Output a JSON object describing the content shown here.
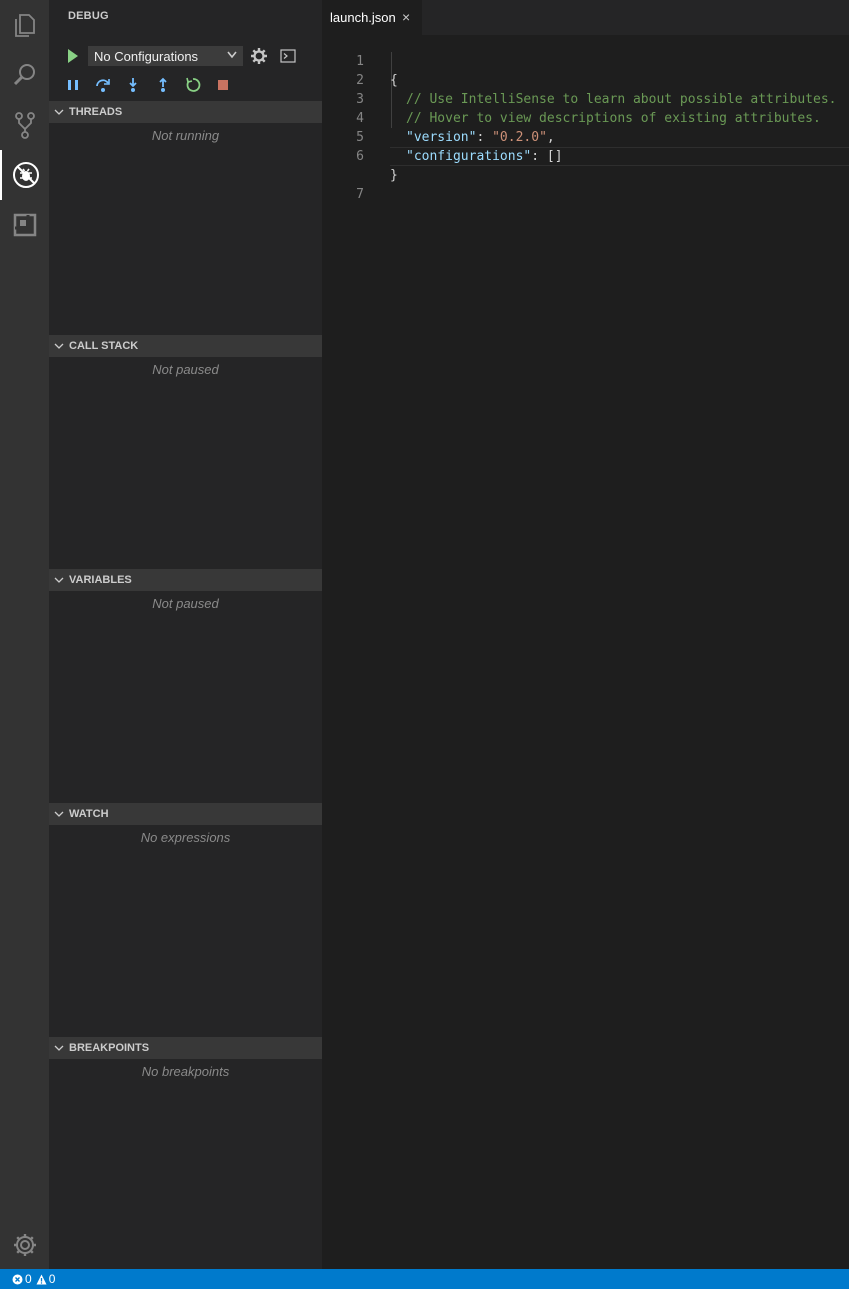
{
  "activity_bar": {
    "items": [
      {
        "icon": "files-icon"
      },
      {
        "icon": "search-icon"
      },
      {
        "icon": "source-control-icon"
      },
      {
        "icon": "debug-icon",
        "active": true
      },
      {
        "icon": "extensions-icon"
      }
    ],
    "settings_icon": "gear-icon"
  },
  "sidebar": {
    "title": "DEBUG",
    "config_select": "No Configurations",
    "sections": [
      {
        "label": "THREADS",
        "status": "Not running"
      },
      {
        "label": "CALL STACK",
        "status": "Not paused"
      },
      {
        "label": "VARIABLES",
        "status": "Not paused"
      },
      {
        "label": "WATCH",
        "status": "No expressions"
      },
      {
        "label": "BREAKPOINTS",
        "status": "No breakpoints"
      }
    ]
  },
  "editor": {
    "tab": {
      "label": "launch.json",
      "close": "×"
    },
    "lines": [
      {
        "no": "1",
        "text": "{"
      },
      {
        "no": "2",
        "text": "// Use IntelliSense to learn about possible attributes."
      },
      {
        "no": "3",
        "text": "// Hover to view descriptions of existing attributes."
      },
      {
        "no": "4",
        "key": "\"version\"",
        "sep": ": ",
        "value": "\"0.2.0\"",
        "end": ","
      },
      {
        "no": "5",
        "key": "\"configurations\"",
        "sep": ": ",
        "value": "[]",
        "end": ""
      },
      {
        "no": "6",
        "text": "}"
      },
      {
        "no": "7",
        "text": ""
      }
    ]
  },
  "statusbar": {
    "errors": "0",
    "warnings": "0"
  },
  "colors": {
    "statusbar": "#007acc",
    "run": "#89d185",
    "stop": "#f48771",
    "restart": "#89d185",
    "step": "#75beff"
  }
}
